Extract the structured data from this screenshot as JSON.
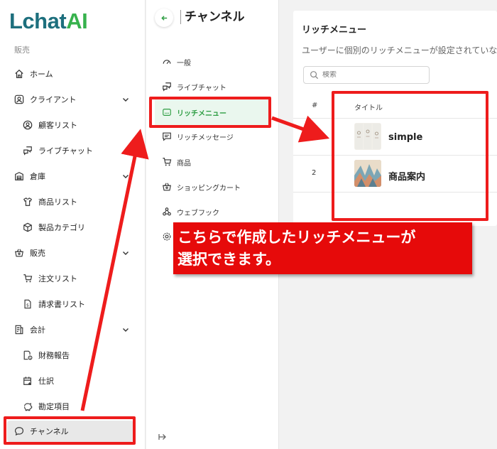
{
  "brand": {
    "logo_main": "Lchat",
    "logo_accent": "AI"
  },
  "sidebar": {
    "section_label": "販売",
    "items": [
      {
        "label": "ホーム"
      },
      {
        "label": "クライアント"
      },
      {
        "label": "顧客リスト"
      },
      {
        "label": "ライブチャット"
      },
      {
        "label": "倉庫"
      },
      {
        "label": "商品リスト"
      },
      {
        "label": "製品カテゴリ"
      },
      {
        "label": "販売"
      },
      {
        "label": "注文リスト"
      },
      {
        "label": "請求書リスト"
      },
      {
        "label": "会計"
      },
      {
        "label": "財務報告"
      },
      {
        "label": "仕訳"
      },
      {
        "label": "勘定項目"
      }
    ],
    "channel": {
      "label": "チャンネル"
    }
  },
  "channel_panel": {
    "title": "チャンネル",
    "items": [
      {
        "label": "一般"
      },
      {
        "label": "ライブチャット"
      },
      {
        "label": "リッチメニュー"
      },
      {
        "label": "リッチメッセージ"
      },
      {
        "label": "商品"
      },
      {
        "label": "ショッピングカート"
      },
      {
        "label": "ウェブフック"
      }
    ]
  },
  "main": {
    "title": "リッチメニュー",
    "description": "ユーザーに個別のリッチメニューが設定されていない",
    "search": {
      "placeholder": "検索"
    },
    "table": {
      "headers": [
        "#",
        "タイトル"
      ],
      "rows": [
        {
          "num": "",
          "title": "simple"
        },
        {
          "num": "2",
          "title": "商品案内"
        }
      ]
    }
  },
  "annotation": {
    "line1": "こちらで作成したリッチメニューが",
    "line2": "選択できます。",
    "color": "#e60a0a"
  },
  "colors": {
    "brand_dark": "#1d6f7d",
    "brand_green": "#37b24d",
    "active_green": "#2f9e44"
  }
}
